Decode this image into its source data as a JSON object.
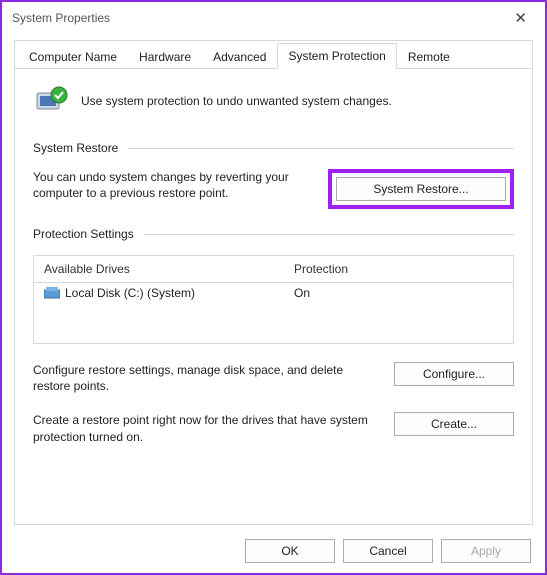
{
  "window": {
    "title": "System Properties"
  },
  "tabs": {
    "computer_name": "Computer Name",
    "hardware": "Hardware",
    "advanced": "Advanced",
    "system_protection": "System Protection",
    "remote": "Remote"
  },
  "intro": "Use system protection to undo unwanted system changes.",
  "sections": {
    "restore": "System Restore",
    "protection": "Protection Settings"
  },
  "restore": {
    "desc": "You can undo system changes by reverting your computer to a previous restore point.",
    "button": "System Restore..."
  },
  "drives_table": {
    "col_drives": "Available Drives",
    "col_protection": "Protection",
    "rows": [
      {
        "name": "Local Disk (C:) (System)",
        "protection": "On"
      }
    ]
  },
  "configure": {
    "desc": "Configure restore settings, manage disk space, and delete restore points.",
    "button": "Configure..."
  },
  "create": {
    "desc": "Create a restore point right now for the drives that have system protection turned on.",
    "button": "Create..."
  },
  "footer": {
    "ok": "OK",
    "cancel": "Cancel",
    "apply": "Apply"
  }
}
